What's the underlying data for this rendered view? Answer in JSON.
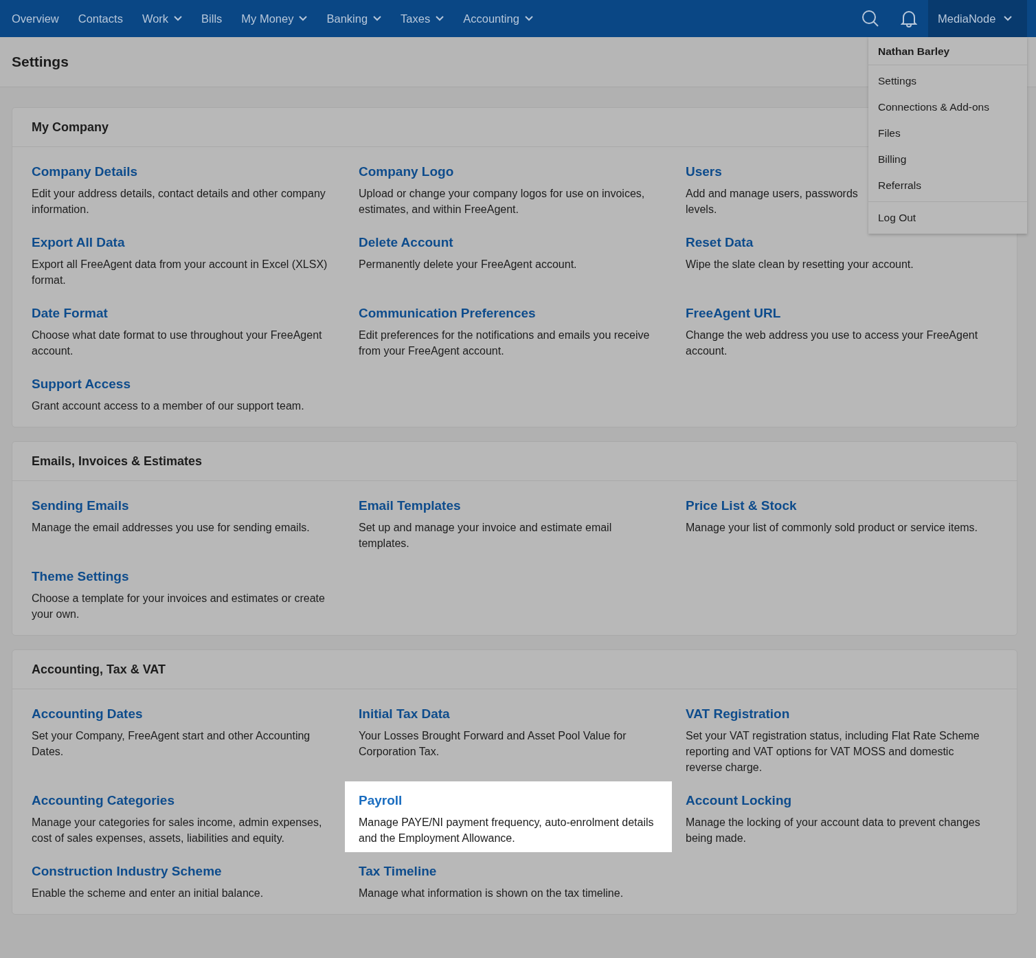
{
  "nav": {
    "items": [
      {
        "label": "Overview",
        "has_dropdown": false
      },
      {
        "label": "Contacts",
        "has_dropdown": false
      },
      {
        "label": "Work",
        "has_dropdown": true
      },
      {
        "label": "Bills",
        "has_dropdown": false
      },
      {
        "label": "My Money",
        "has_dropdown": true
      },
      {
        "label": "Banking",
        "has_dropdown": true
      },
      {
        "label": "Taxes",
        "has_dropdown": true
      },
      {
        "label": "Accounting",
        "has_dropdown": true
      }
    ],
    "account": {
      "label": "MediaNode",
      "expanded": true
    }
  },
  "account_menu": {
    "header": "Nathan Barley",
    "groups": [
      [
        "Settings",
        "Connections & Add-ons",
        "Files",
        "Billing",
        "Referrals"
      ],
      [
        "Log Out"
      ]
    ]
  },
  "page_title": "Settings",
  "sections": [
    {
      "title": "My Company",
      "items": [
        {
          "title": "Company Details",
          "description": "Edit your address details, contact details and other company information.",
          "highlighted": false
        },
        {
          "title": "Company Logo",
          "description": "Upload or change your company logos for use on invoices, estimates, and within FreeAgent.",
          "highlighted": false
        },
        {
          "title": "Users",
          "description": "Add and manage users, passwords",
          "description_2": "levels.",
          "highlighted": false
        },
        {
          "title": "Export All Data",
          "description": "Export all FreeAgent data from your account in Excel (XLSX) format.",
          "highlighted": false
        },
        {
          "title": "Delete Account",
          "description": "Permanently delete your FreeAgent account.",
          "highlighted": false
        },
        {
          "title": "Reset Data",
          "description": "Wipe the slate clean by resetting your account.",
          "highlighted": false
        },
        {
          "title": "Date Format",
          "description": "Choose what date format to use throughout your FreeAgent account.",
          "highlighted": false
        },
        {
          "title": "Communication Preferences",
          "description": "Edit preferences for the notifications and emails you receive from your FreeAgent account.",
          "highlighted": false
        },
        {
          "title": "FreeAgent URL",
          "description": "Change the web address you use to access your FreeAgent account.",
          "highlighted": false
        },
        {
          "title": "Support Access",
          "description": "Grant account access to a member of our support team.",
          "highlighted": false
        }
      ]
    },
    {
      "title": "Emails, Invoices & Estimates",
      "items": [
        {
          "title": "Sending Emails",
          "description": "Manage the email addresses you use for sending emails.",
          "highlighted": false
        },
        {
          "title": "Email Templates",
          "description": "Set up and manage your invoice and estimate email templates.",
          "highlighted": false
        },
        {
          "title": "Price List & Stock",
          "description": "Manage your list of commonly sold product or service items.",
          "highlighted": false
        },
        {
          "title": "Theme Settings",
          "description": "Choose a template for your invoices and estimates or create your own.",
          "highlighted": false
        }
      ]
    },
    {
      "title": "Accounting, Tax & VAT",
      "items": [
        {
          "title": "Accounting Dates",
          "description": "Set your Company, FreeAgent start and other Accounting Dates.",
          "highlighted": false
        },
        {
          "title": "Initial Tax Data",
          "description": "Your Losses Brought Forward and Asset Pool Value for Corporation Tax.",
          "highlighted": false
        },
        {
          "title": "VAT Registration",
          "description": "Set your VAT registration status, including Flat Rate Scheme reporting and VAT options for VAT MOSS and domestic reverse charge.",
          "highlighted": false
        },
        {
          "title": "Accounting Categories",
          "description": "Manage your categories for sales income, admin expenses, cost of sales expenses, assets, liabilities and equity.",
          "highlighted": false
        },
        {
          "title": "Payroll",
          "description": "Manage PAYE/NI payment frequency, auto-enrolment details and the Employment Allowance.",
          "highlighted": true
        },
        {
          "title": "Account Locking",
          "description": "Manage the locking of your account data to prevent changes being made.",
          "highlighted": false
        },
        {
          "title": "Construction Industry Scheme",
          "description": "Enable the scheme and enter an initial balance.",
          "highlighted": false
        },
        {
          "title": "Tax Timeline",
          "description": "Manage what information is shown on the tax timeline.",
          "highlighted": false
        }
      ]
    }
  ]
}
